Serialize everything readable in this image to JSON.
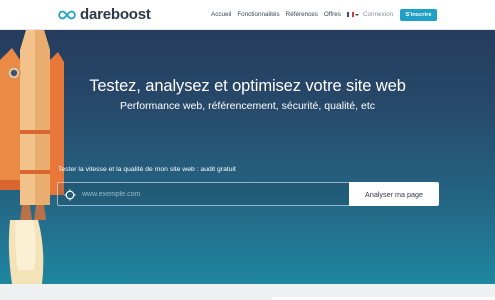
{
  "header": {
    "logo_text": "dareboost",
    "nav": {
      "accueil": "Accueil",
      "fonctionnalites": "Fonctionnalités",
      "references": "Références",
      "offres": "Offres"
    },
    "language_flag": "fr-flag-icon",
    "connexion": "Connexion",
    "signup": "S'inscrire"
  },
  "hero": {
    "title": "Testez, analysez et optimisez votre site web",
    "subtitle": "Performance web, référencement, sécurité, qualité, etc",
    "audit_label": "Tester la vitesse et la qualité de mon site web : audit gratuit",
    "url_placeholder": "www.exemple.com",
    "analyze_button": "Analyser ma page"
  },
  "colors": {
    "accent": "#1fa0c7",
    "hero_top": "#263c5d",
    "hero_bottom": "#1f86a0",
    "rocket_body": "#f2c28a",
    "rocket_orange": "#e8773a"
  }
}
